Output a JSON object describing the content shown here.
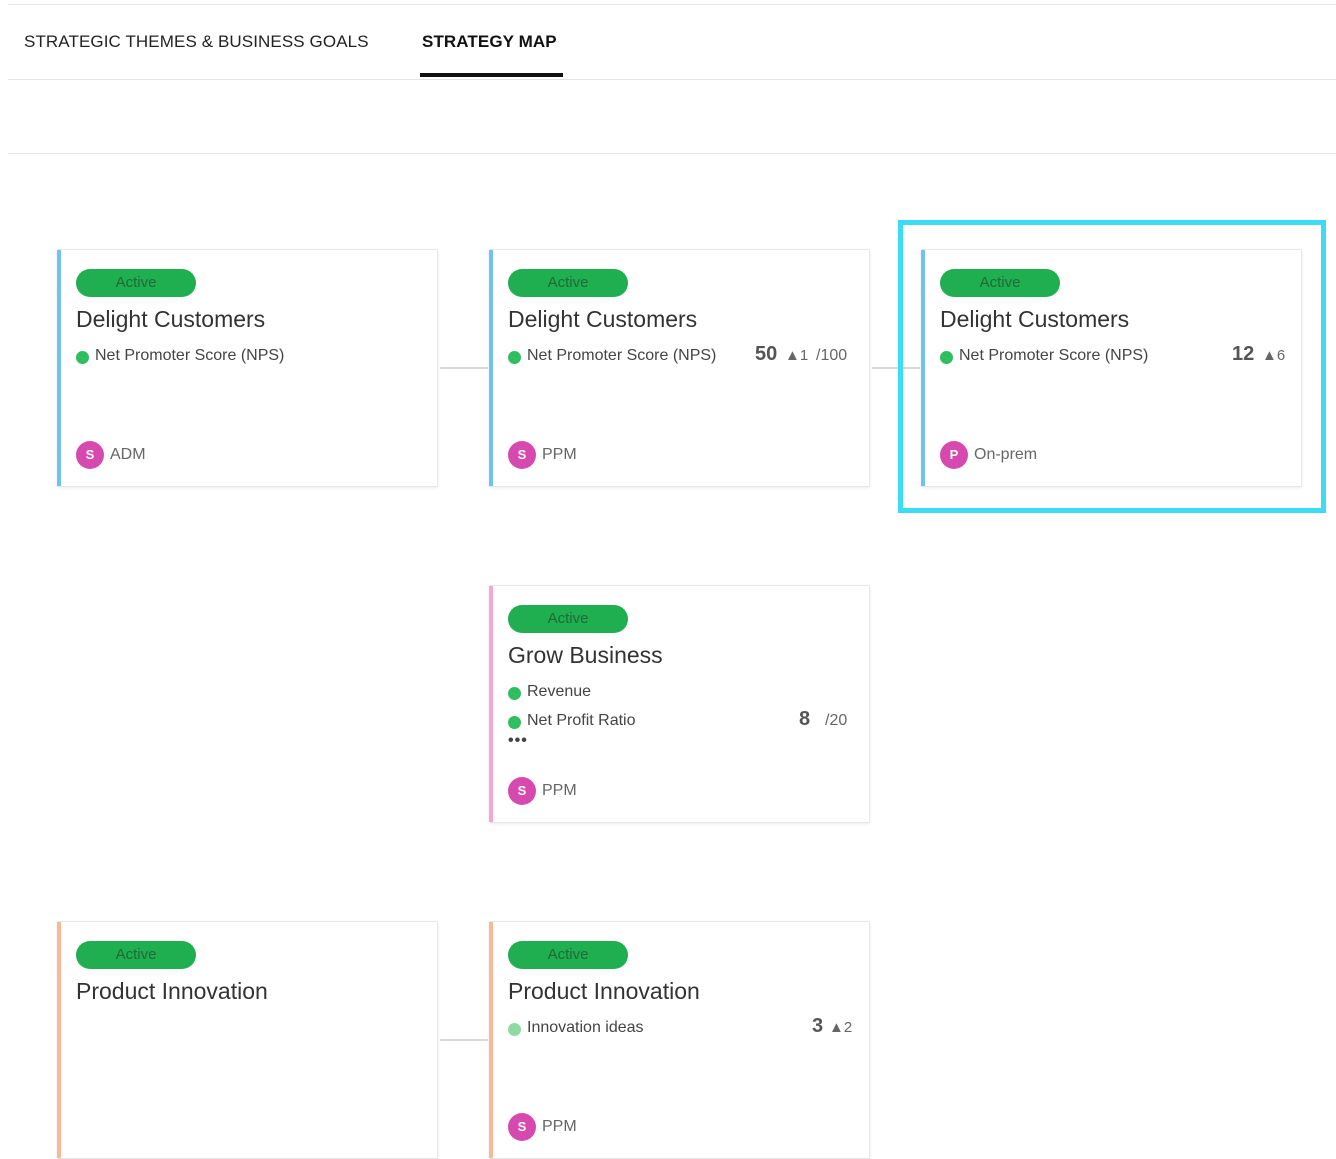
{
  "tabs": [
    {
      "label": "STRATEGIC THEMES & BUSINESS GOALS"
    },
    {
      "label": "STRATEGY MAP"
    }
  ],
  "colors": {
    "status_active": "#1fae50",
    "stripe_blue": "#6ec3f4",
    "stripe_pink": "#f7a6d3",
    "stripe_orange": "#f6b994",
    "avatar": "#d64ab0",
    "highlight": "#3ddcf5"
  },
  "cards": [
    {
      "status": "Active",
      "title": "Delight Customers",
      "metrics": [
        {
          "label": "Net Promoter Score  (NPS)"
        }
      ],
      "owner": {
        "initial": "S",
        "name": "ADM"
      }
    },
    {
      "status": "Active",
      "title": "Delight Customers",
      "metrics": [
        {
          "label": "Net Promoter Score  (NPS)",
          "value": "50",
          "change": "▲1",
          "target": "/100"
        }
      ],
      "owner": {
        "initial": "S",
        "name": "PPM"
      }
    },
    {
      "status": "Active",
      "title": "Delight Customers",
      "metrics": [
        {
          "label": "Net Promoter Score  (NPS)",
          "value": "12",
          "change": "▲6"
        }
      ],
      "owner": {
        "initial": "P",
        "name": "On-prem"
      }
    },
    {
      "status": "Active",
      "title": "Grow Business",
      "metrics": [
        {
          "label": "Revenue"
        },
        {
          "label": "Net Profit Ratio",
          "value": "8",
          "target": "/20"
        }
      ],
      "more": "•••",
      "owner": {
        "initial": "S",
        "name": "PPM"
      }
    },
    {
      "status": "Active",
      "title": "Product Innovation",
      "metrics": []
    },
    {
      "status": "Active",
      "title": "Product Innovation",
      "metrics": [
        {
          "label": "Innovation ideas",
          "value": "3",
          "change": "▲2"
        }
      ],
      "owner": {
        "initial": "S",
        "name": "PPM"
      }
    }
  ]
}
